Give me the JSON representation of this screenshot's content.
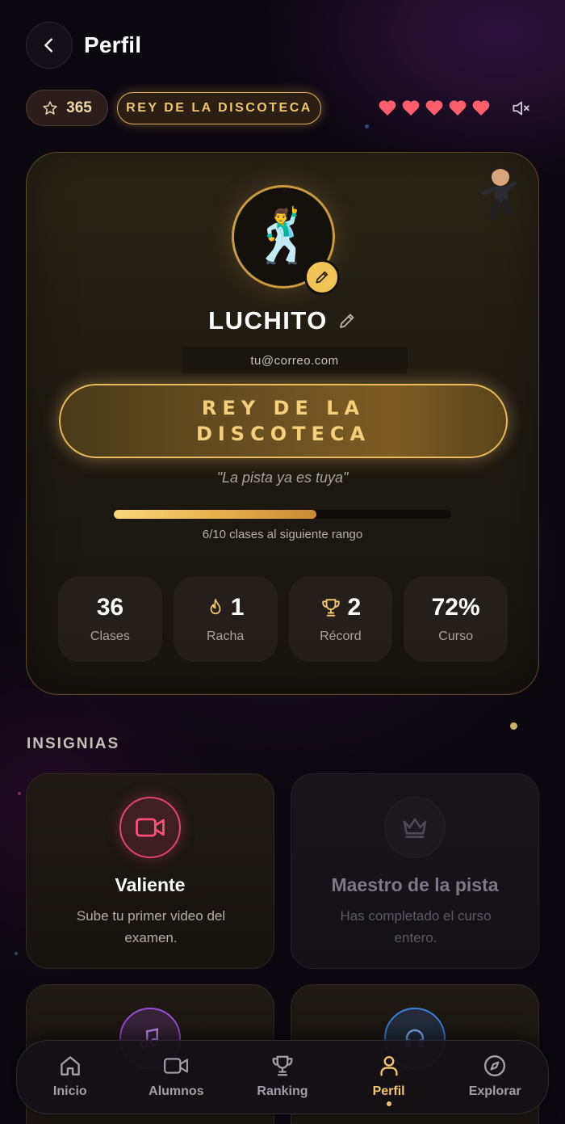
{
  "header": {
    "title": "Perfil"
  },
  "status": {
    "points": "365",
    "rank_badge": "REY DE LA DISCOTECA",
    "hearts": 5
  },
  "profile": {
    "avatar_emoji": "🕺",
    "username": "LUCHITO",
    "email": "tu@correo.com",
    "rank_title": "REY DE LA DISCOTECA",
    "quote": "\"La pista ya es tuya\"",
    "progress": {
      "completed": 6,
      "total": 10,
      "label": "6/10 clases al siguiente rango"
    },
    "stats": [
      {
        "value": "36",
        "label": "Clases",
        "icon": ""
      },
      {
        "value": "1",
        "label": "Racha",
        "icon": "flame-icon"
      },
      {
        "value": "2",
        "label": "Récord",
        "icon": "trophy-icon"
      },
      {
        "value": "72%",
        "label": "Curso",
        "icon": ""
      }
    ]
  },
  "badges": {
    "section_title": "INSIGNIAS",
    "items": [
      {
        "title": "Valiente",
        "description": "Sube tu primer video del examen.",
        "icon": "video-camera-icon",
        "locked": false,
        "color": "#e0456e"
      },
      {
        "title": "Maestro de la pista",
        "description": "Has completado el curso entero.",
        "icon": "crown-icon",
        "locked": true,
        "color": "#6b6670"
      },
      {
        "title": "",
        "description": "",
        "icon": "music-note-icon",
        "locked": false,
        "color": "#9b4fd6"
      },
      {
        "title": "",
        "description": "",
        "icon": "headphones-icon",
        "locked": false,
        "color": "#3f7fe0"
      }
    ]
  },
  "nav": {
    "items": [
      {
        "label": "Inicio",
        "icon": "home-icon",
        "active": false
      },
      {
        "label": "Alumnos",
        "icon": "video-camera-icon",
        "active": false
      },
      {
        "label": "Ranking",
        "icon": "trophy-icon",
        "active": false
      },
      {
        "label": "Perfil",
        "icon": "user-icon",
        "active": true
      },
      {
        "label": "Explorar",
        "icon": "compass-icon",
        "active": false
      }
    ]
  },
  "colors": {
    "accent": "#f0c66d",
    "heart": "#ff5f6d",
    "background": "#0c0810"
  }
}
